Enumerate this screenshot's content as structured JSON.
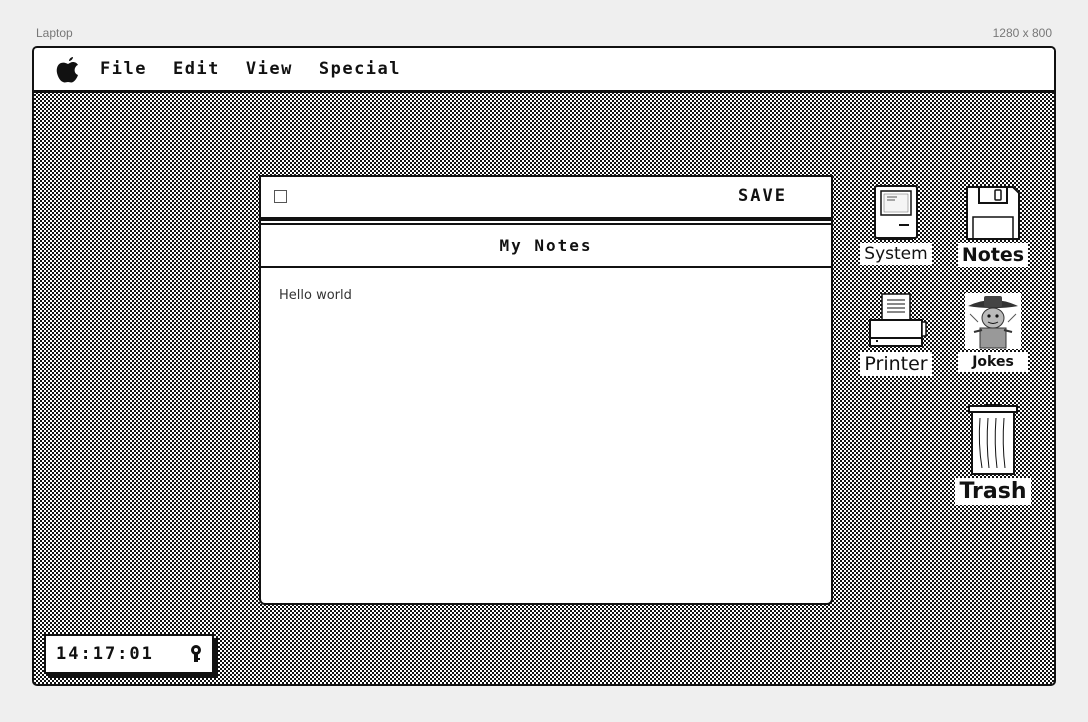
{
  "frame": {
    "device_label": "Laptop",
    "resolution_label": "1280 x 800"
  },
  "menubar": {
    "logo_icon": "apple-icon",
    "items": [
      {
        "label": "File"
      },
      {
        "label": "Edit"
      },
      {
        "label": "View"
      },
      {
        "label": "Special"
      }
    ]
  },
  "notes_window": {
    "save_label": "SAVE",
    "title": "My Notes",
    "content": "Hello world"
  },
  "desktop_icons": [
    {
      "label": "System",
      "icon": "computer-icon"
    },
    {
      "label": "Notes",
      "icon": "floppy-disk-icon"
    },
    {
      "label": "Printer",
      "icon": "printer-icon"
    },
    {
      "label": "Jokes",
      "icon": "cowboy-picture-icon"
    },
    {
      "label": "Trash",
      "icon": "trash-can-icon"
    }
  ],
  "clock": {
    "time": "14:17:01",
    "icon": "lock-icon"
  },
  "colors": {
    "foreground": "#111111",
    "background": "#ffffff"
  }
}
